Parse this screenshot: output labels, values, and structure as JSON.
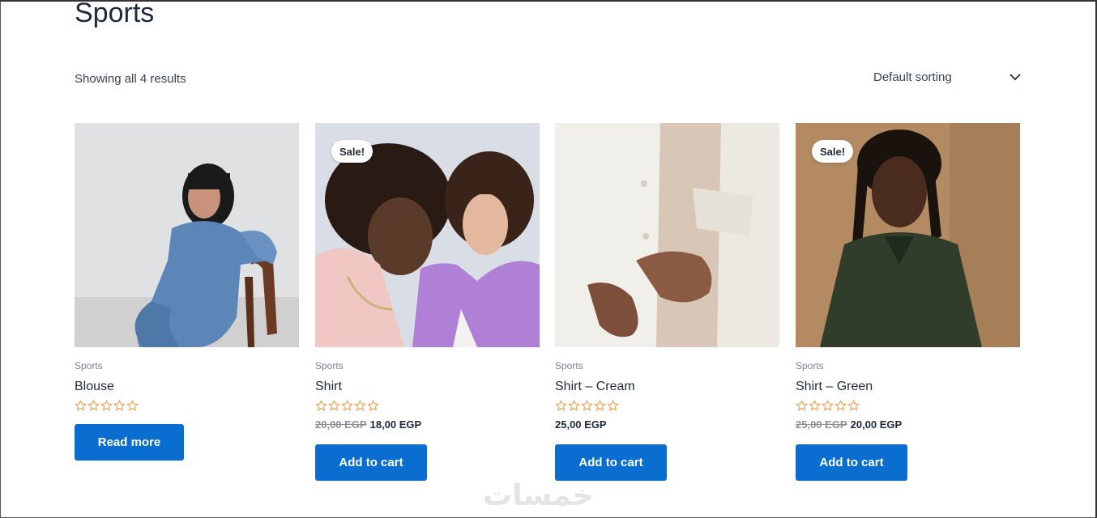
{
  "page": {
    "title": "Sports"
  },
  "toolbar": {
    "result_count": "Showing all 4 results",
    "sorting_label": "Default sorting"
  },
  "products": [
    {
      "category": "Sports",
      "name": "Blouse",
      "rating": 0,
      "sale": false,
      "price_old": "",
      "price": "",
      "button_label": "Read more"
    },
    {
      "category": "Sports",
      "name": "Shirt",
      "rating": 0,
      "sale": true,
      "sale_label": "Sale!",
      "price_old": "20,00 EGP",
      "price": "18,00 EGP",
      "button_label": "Add to cart"
    },
    {
      "category": "Sports",
      "name": "Shirt – Cream",
      "rating": 0,
      "sale": false,
      "price_old": "",
      "price": "25,00 EGP",
      "button_label": "Add to cart"
    },
    {
      "category": "Sports",
      "name": "Shirt – Green",
      "rating": 0,
      "sale": true,
      "sale_label": "Sale!",
      "price_old": "25,00 EGP",
      "price": "20,00 EGP",
      "button_label": "Add to cart"
    }
  ],
  "watermark": "خمسات",
  "colors": {
    "button": "#0a6ed1",
    "star": "#f0a04b",
    "text": "#1e2a3b"
  }
}
